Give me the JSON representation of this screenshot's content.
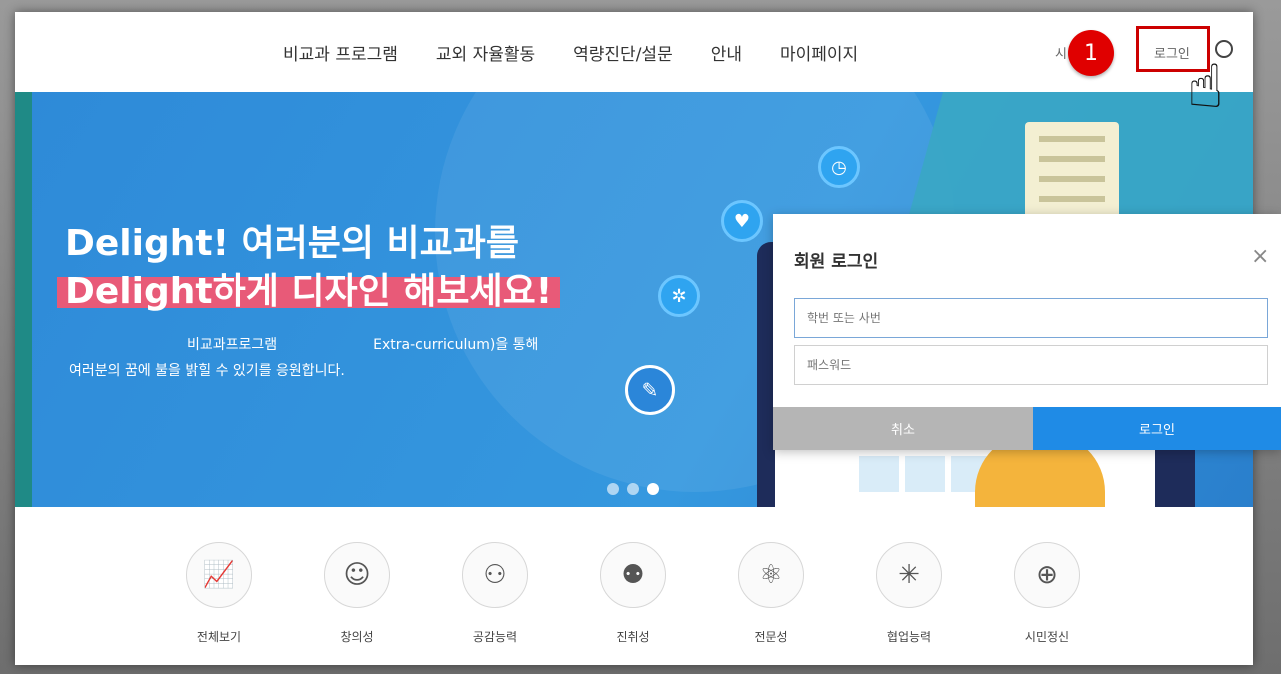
{
  "nav": {
    "items": [
      "비교과 프로그램",
      "교외 자율활동",
      "역량진단/설문",
      "안내",
      "마이페이지"
    ],
    "util_partial": "시",
    "login_label": "로그인"
  },
  "hero": {
    "title_line1": "Delight! 여러분의 비교과를",
    "title_line2": "Delight하게 디자인 해보세요!",
    "sub_left": "비교과프로그램",
    "sub_right": "Extra-curriculum)을 통해",
    "sub_line2": "여러분의 꿈에 불을 밝힐 수 있기를 응원합니다.",
    "slides": 3,
    "active_slide": 3
  },
  "categories": [
    {
      "label": "전체보기",
      "icon": "chart-icon"
    },
    {
      "label": "창의성",
      "icon": "head-icon"
    },
    {
      "label": "공감능력",
      "icon": "team-icon"
    },
    {
      "label": "진취성",
      "icon": "group-icon"
    },
    {
      "label": "전문성",
      "icon": "atom-icon"
    },
    {
      "label": "협업능력",
      "icon": "network-icon"
    },
    {
      "label": "시민정신",
      "icon": "globe-person-icon"
    }
  ],
  "login_modal": {
    "title": "회원 로그인",
    "id_placeholder": "학번 또는 사번",
    "pw_placeholder": "패스워드",
    "cancel_label": "취소",
    "submit_label": "로그인"
  },
  "annotation": {
    "step": "1"
  },
  "colors": {
    "hero_blue": "#3598df",
    "login_button": "#1f8be6",
    "cancel_button": "#b5b5b5",
    "highlight": "#e85a78",
    "annotation_red": "#cc0000"
  }
}
